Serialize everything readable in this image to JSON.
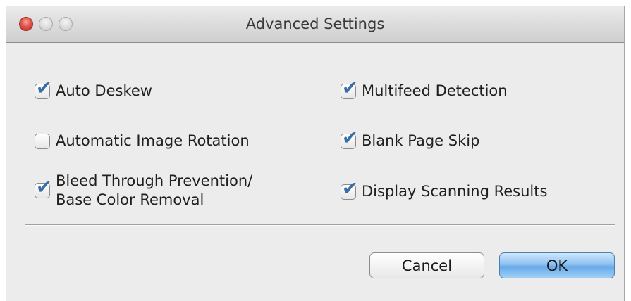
{
  "window": {
    "title": "Advanced Settings"
  },
  "options": {
    "auto_deskew": {
      "label": "Auto Deskew",
      "checked": true
    },
    "automatic_image_rotation": {
      "label": "Automatic Image Rotation",
      "checked": false
    },
    "bleed_through": {
      "label_line1": "Bleed Through Prevention/",
      "label_line2": "Base Color Removal",
      "checked": true
    },
    "multifeed_detection": {
      "label": "Multifeed Detection",
      "checked": true
    },
    "blank_page_skip": {
      "label": "Blank Page Skip",
      "checked": true
    },
    "display_scanning_results": {
      "label": "Display Scanning Results",
      "checked": true
    }
  },
  "buttons": {
    "cancel": "Cancel",
    "ok": "OK"
  },
  "icons": {
    "check": "✔"
  }
}
